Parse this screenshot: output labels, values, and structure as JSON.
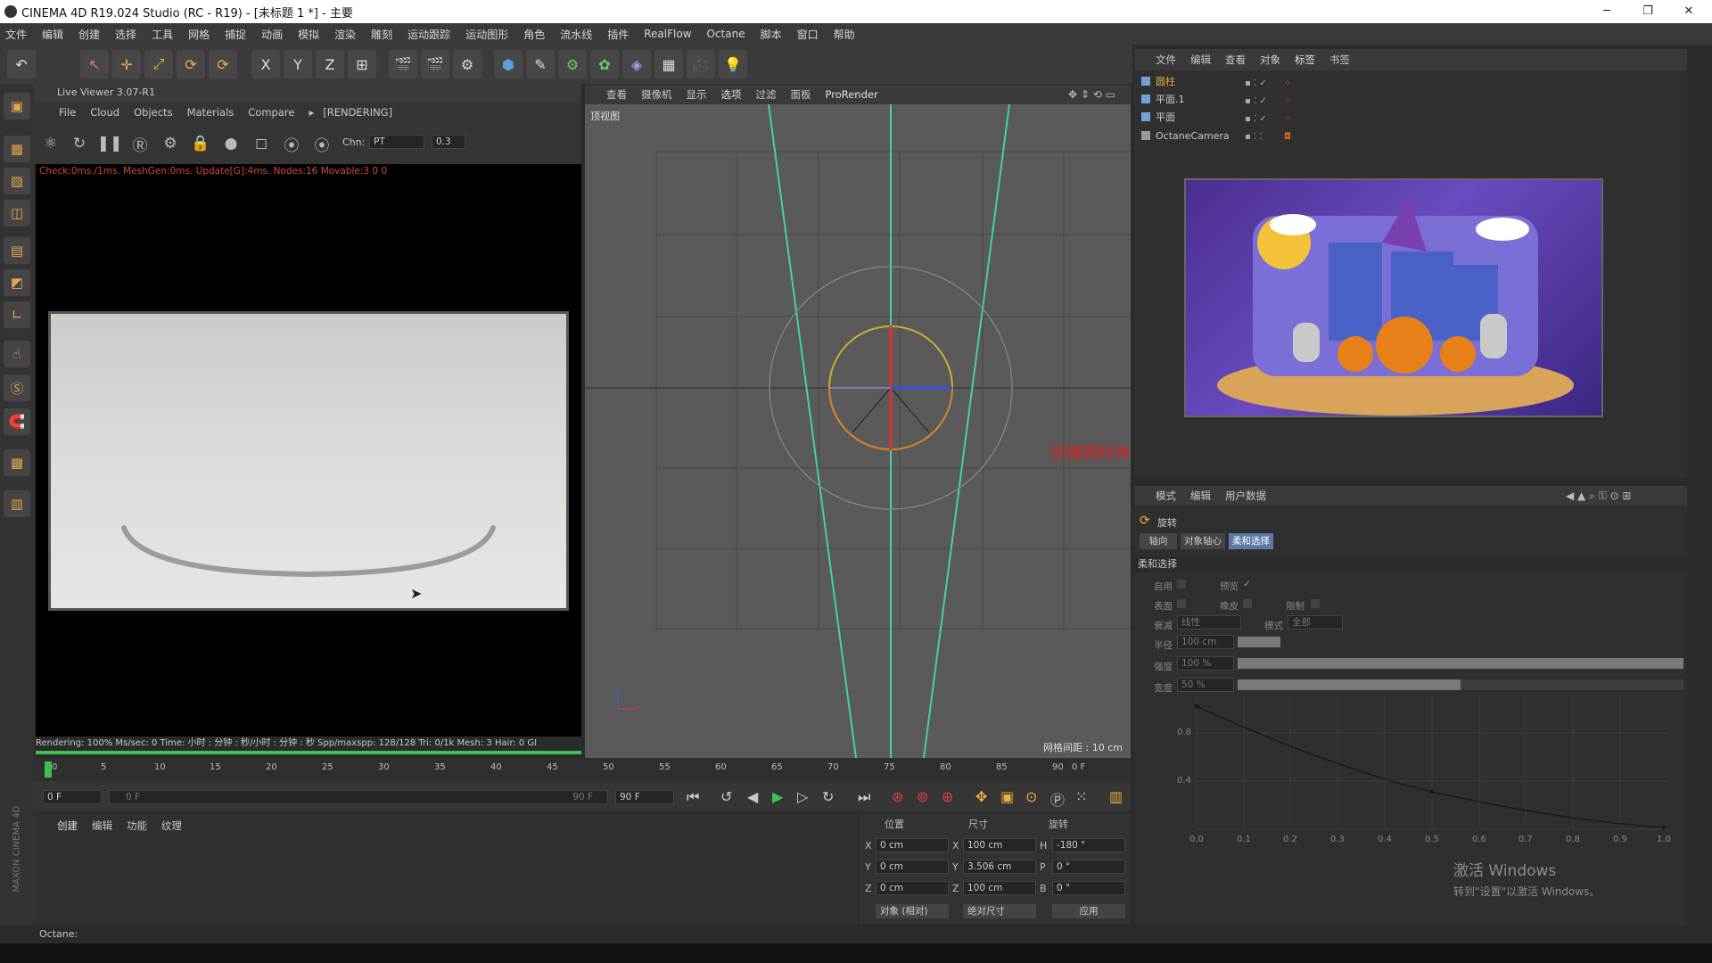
{
  "titlebar": {
    "title": "CINEMA 4D R19.024 Studio (RC - R19) - [未标题 1 *] - 主要",
    "minimize": "─",
    "maximize": "❐",
    "close": "✕"
  },
  "menubar": [
    "文件",
    "编辑",
    "创建",
    "选择",
    "工具",
    "网格",
    "捕捉",
    "动画",
    "模拟",
    "渲染",
    "雕刻",
    "运动跟踪",
    "运动图形",
    "角色",
    "流水线",
    "插件",
    "RealFlow",
    "Octane",
    "脚本",
    "窗口",
    "帮助"
  ],
  "toolbar": {
    "undo": "↶",
    "select": "↖",
    "move": "✛",
    "scale": "⤢",
    "rotate": "⟳",
    "rotate2": "⟳",
    "x": "X",
    "y": "Y",
    "z": "Z",
    "coord": "⊞",
    "render_view": "🎬",
    "render_pic": "🎬",
    "render_settings": "⚙",
    "cube": "⬢",
    "pen": "✎",
    "gear": "⚙",
    "sym": "✿",
    "deformer": "◈",
    "floor": "▦",
    "camera": "🎥",
    "light": "💡"
  },
  "left_tools": [
    "▣",
    "▦",
    "▨",
    "◫",
    "▤",
    "◩",
    "∟",
    "☝",
    "Ⓢ",
    "🧲",
    "▩",
    "▥"
  ],
  "live_viewer": {
    "title": "Live Viewer 3.07-R1",
    "menu": [
      "File",
      "Cloud",
      "Objects",
      "Materials",
      "Compare"
    ],
    "state": "[RENDERING]",
    "chn_label": "Chn:",
    "chn_value": "PT",
    "chn_num": "0.3",
    "check_line": "Check:0ms./1ms. MeshGen:0ms. Update[G]:4ms. Nodes:16 Movable:3  0 0",
    "status": "Rendering: 100%    Ms/sec: 0    Time: 小时 : 分钟 : 秒/小时 : 分钟 : 秒    Spp/maxspp: 128/128      Tri: 0/1k     Mesh: 3     Hair: 0    GI"
  },
  "viewport": {
    "tabs": [
      "查看",
      "摄像机",
      "显示",
      "选项",
      "过滤",
      "面板",
      "ProRender"
    ],
    "name": "顶视图",
    "grid_info": "网格间距 : 10 cm",
    "annotation": "创建圆柱体"
  },
  "object_manager": {
    "tabs": [
      "文件",
      "编辑",
      "查看",
      "对象",
      "标签",
      "书签"
    ],
    "objects": [
      {
        "name": "圆柱",
        "color": "#e0b040"
      },
      {
        "name": "平面.1",
        "color": "#c8c8c8"
      },
      {
        "name": "平面",
        "color": "#c8c8c8"
      },
      {
        "name": "OctaneCamera",
        "color": "#c8c8c8"
      }
    ]
  },
  "attribute_manager": {
    "tabs": [
      "模式",
      "编辑",
      "用户数据"
    ],
    "tool_name": "旋转",
    "subtabs": [
      "轴向",
      "对象轴心",
      "柔和选择"
    ],
    "section": "柔和选择",
    "params": {
      "enable": "启用",
      "preview": "预览",
      "surface": "表面",
      "rubber": "橡皮",
      "restrict": "限制",
      "falloff": "衰减",
      "falloff_val": "线性",
      "mode": "模式",
      "mode_val": "全部",
      "radius": "半径",
      "radius_val": "100 cm",
      "strength": "强度",
      "strength_val": "100 %",
      "width": "宽度",
      "width_val": "50 %"
    },
    "curve_y": [
      "0.8",
      "0.4"
    ],
    "curve_x": [
      "0.0",
      "0.1",
      "0.2",
      "0.3",
      "0.4",
      "0.5",
      "0.6",
      "0.7",
      "0.8",
      "0.9",
      "1.0"
    ]
  },
  "timeline": {
    "ticks": [
      "0",
      "5",
      "10",
      "15",
      "20",
      "25",
      "30",
      "35",
      "40",
      "45",
      "50",
      "55",
      "60",
      "65",
      "70",
      "75",
      "80",
      "85",
      "90"
    ],
    "frame_end": "0 F",
    "start": "0 F",
    "range_start": "0 F",
    "range_end": "90 F",
    "end": "90 F"
  },
  "bottom_tabs": [
    "创建",
    "编辑",
    "功能",
    "纹理"
  ],
  "coords": {
    "headers": [
      "位置",
      "尺寸",
      "旋转"
    ],
    "rows": [
      {
        "axis": "X",
        "pos": "0 cm",
        "size_axis": "X",
        "size": "100 cm",
        "rot_axis": "H",
        "rot": "-180 °"
      },
      {
        "axis": "Y",
        "pos": "0 cm",
        "size_axis": "Y",
        "size": "3.506 cm",
        "rot_axis": "P",
        "rot": "0 °"
      },
      {
        "axis": "Z",
        "pos": "0 cm",
        "size_axis": "Z",
        "size": "100 cm",
        "rot_axis": "B",
        "rot": "0 °"
      }
    ],
    "mode1": "对象 (相对)",
    "mode2": "绝对尺寸",
    "apply": "应用"
  },
  "statusbar": {
    "text": "Octane:"
  },
  "watermark": {
    "line1": "激活 Windows",
    "line2": "转到\"设置\"以激活 Windows。"
  },
  "side_logo": "MAXON CINEMA 4D"
}
